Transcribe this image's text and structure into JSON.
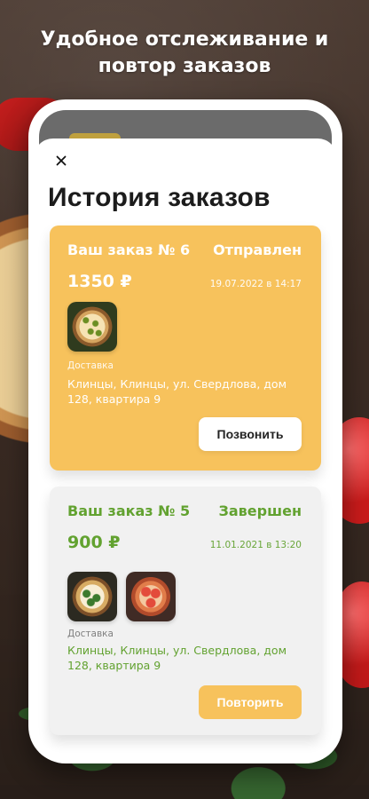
{
  "headline": "Удобное отслеживание и повтор заказов",
  "screen": {
    "title": "История заказов",
    "close_icon": "close-icon"
  },
  "orders": [
    {
      "title": "Ваш заказ № 6",
      "status": "Отправлен",
      "amount": "1350 ₽",
      "datetime": "19.07.2022 в 14:17",
      "delivery_label": "Доставка",
      "address": "Клинцы, Клинцы, ул. Свердлова, дом 128, квартира 9",
      "action_label": "Позвонить",
      "theme": {
        "card_bg": "#F7C25C",
        "text": "#FFFFFF"
      },
      "items": [
        {
          "icon": "pizza-thumbnail"
        }
      ]
    },
    {
      "title": "Ваш заказ № 5",
      "status": "Завершен",
      "amount": "900 ₽",
      "datetime": "11.01.2021 в 13:20",
      "delivery_label": "Доставка",
      "address": "Клинцы, Клинцы, ул. Свердлова, дом 128, квартира 9",
      "action_label": "Повторить",
      "theme": {
        "card_bg": "#F1F1F1",
        "text": "#62A230",
        "button_bg": "#F7C25C"
      },
      "items": [
        {
          "icon": "pizza-thumbnail"
        },
        {
          "icon": "pizza-thumbnail"
        }
      ]
    }
  ]
}
